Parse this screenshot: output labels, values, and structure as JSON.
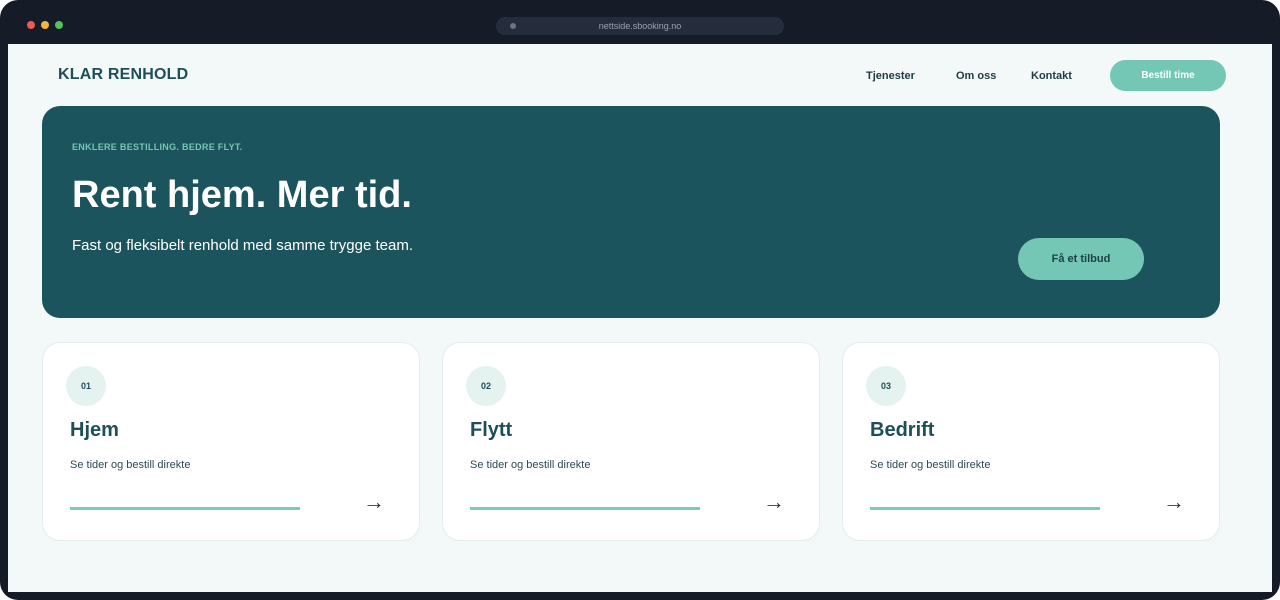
{
  "browser": {
    "url": "nettside.sbooking.no"
  },
  "header": {
    "brand": "KLAR RENHOLD",
    "nav": [
      {
        "label": "Tjenester"
      },
      {
        "label": "Om oss"
      },
      {
        "label": "Kontakt"
      }
    ],
    "cta_label": "Bestill time"
  },
  "hero": {
    "eyebrow": "ENKLERE BESTILLING. BEDRE FLYT.",
    "title": "Rent hjem. Mer tid.",
    "subtitle": "Fast og fleksibelt renhold med samme trygge team.",
    "cta_label": "Få et tilbud"
  },
  "cards": [
    {
      "number": "01",
      "title": "Hjem",
      "description": "Se tider og bestill direkte",
      "arrow": "→"
    },
    {
      "number": "02",
      "title": "Flytt",
      "description": "Se tider og bestill direkte",
      "arrow": "→"
    },
    {
      "number": "03",
      "title": "Bedrift",
      "description": "Se tider og bestill direkte",
      "arrow": "→"
    }
  ],
  "colors": {
    "brand_dark": "#1c545d",
    "accent": "#74c7b5",
    "background": "#f2f9f8",
    "window_chrome": "#161b28"
  }
}
